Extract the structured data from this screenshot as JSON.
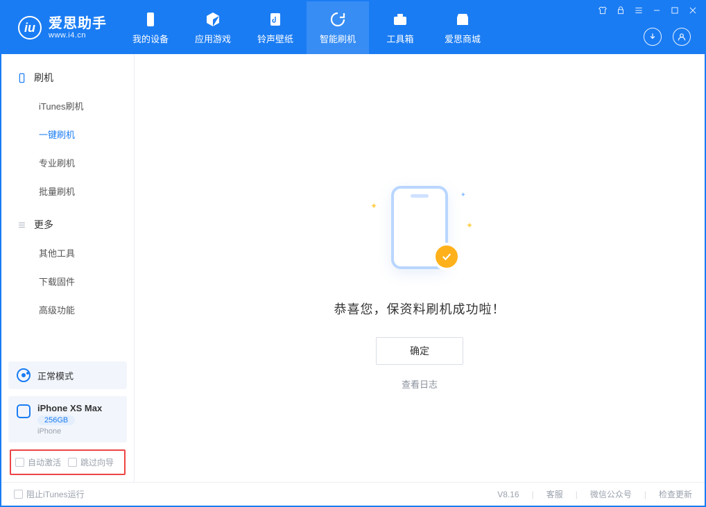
{
  "app": {
    "title": "爱思助手",
    "subtitle": "www.i4.cn"
  },
  "nav": {
    "items": [
      {
        "label": "我的设备"
      },
      {
        "label": "应用游戏"
      },
      {
        "label": "铃声壁纸"
      },
      {
        "label": "智能刷机"
      },
      {
        "label": "工具箱"
      },
      {
        "label": "爱思商城"
      }
    ]
  },
  "sidebar": {
    "group_flash": "刷机",
    "flash_items": [
      "iTunes刷机",
      "一键刷机",
      "专业刷机",
      "批量刷机"
    ],
    "group_more": "更多",
    "more_items": [
      "其他工具",
      "下载固件",
      "高级功能"
    ]
  },
  "mode": {
    "label": "正常模式"
  },
  "device": {
    "name": "iPhone XS Max",
    "capacity": "256GB",
    "type": "iPhone"
  },
  "checks": {
    "auto_activate": "自动激活",
    "skip_guide": "跳过向导"
  },
  "main": {
    "success_text": "恭喜您，保资料刷机成功啦！",
    "ok_label": "确定",
    "log_label": "查看日志"
  },
  "footer": {
    "block_itunes": "阻止iTunes运行",
    "version": "V8.16",
    "links": [
      "客服",
      "微信公众号",
      "检查更新"
    ]
  }
}
